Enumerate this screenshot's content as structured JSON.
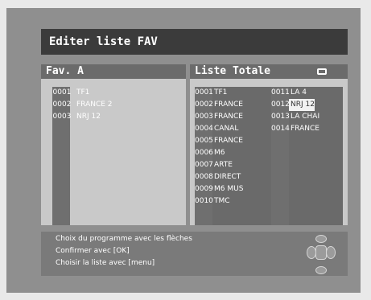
{
  "window": {
    "title": "Editer liste FAV"
  },
  "left_panel": {
    "title": "Fav. A",
    "items": [
      {
        "num": "0001",
        "name": "TF1"
      },
      {
        "num": "0002",
        "name": "FRANCE 2"
      },
      {
        "num": "0003",
        "name": "NRJ 12"
      }
    ]
  },
  "right_panel": {
    "title": "Liste Totale",
    "icon": "tv-icon",
    "column1": [
      {
        "num": "0001",
        "name": "TF1"
      },
      {
        "num": "0002",
        "name": "FRANCE"
      },
      {
        "num": "0003",
        "name": "FRANCE"
      },
      {
        "num": "0004",
        "name": "CANAL"
      },
      {
        "num": "0005",
        "name": "FRANCE"
      },
      {
        "num": "0006",
        "name": "M6"
      },
      {
        "num": "0007",
        "name": "ARTE"
      },
      {
        "num": "0008",
        "name": "DIRECT"
      },
      {
        "num": "0009",
        "name": "M6 MUS"
      },
      {
        "num": "0010",
        "name": "TMC"
      }
    ],
    "column2": [
      {
        "num": "0011",
        "name": "LA 4"
      },
      {
        "num": "0012",
        "name": "NRJ 12",
        "selected": true
      },
      {
        "num": "0013",
        "name": "LA CHAI"
      },
      {
        "num": "0014",
        "name": "FRANCE"
      }
    ]
  },
  "footer": {
    "line1": "Choix du programme avec les flèches",
    "line2": "Confirmer avec [OK]",
    "line3": "Choisir la liste avec [menu]"
  }
}
